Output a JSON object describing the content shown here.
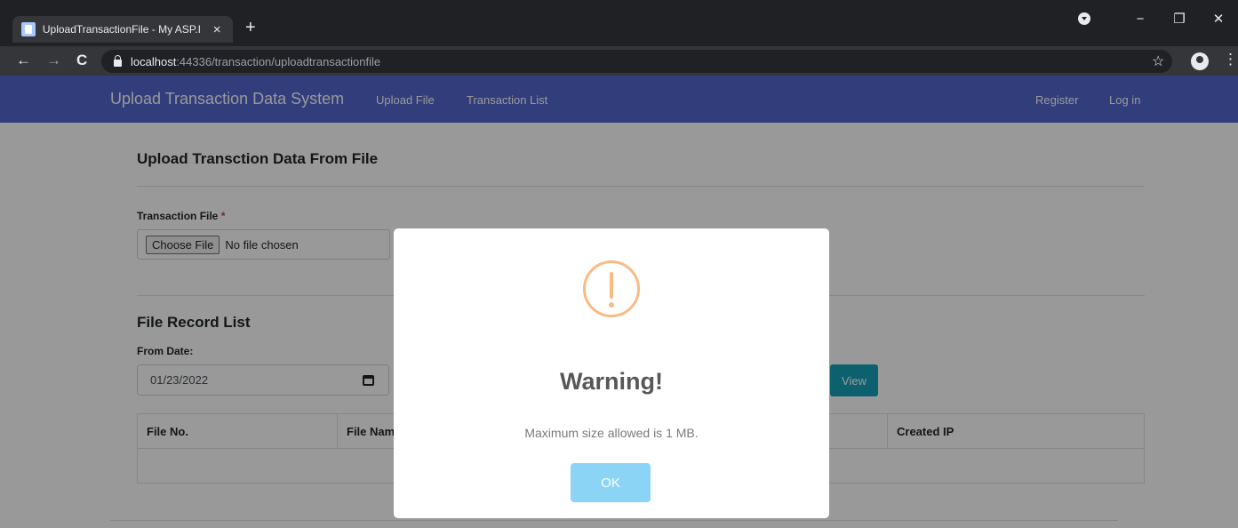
{
  "browser": {
    "tab_title": "UploadTransactionFile - My ASP.I",
    "tab_close": "×",
    "new_tab": "+",
    "url_host": "localhost",
    "url_rest": ":44336/transaction/uploadtransactionfile",
    "window_minimize": "−",
    "window_restore": "❐",
    "window_close": "✕",
    "back": "←",
    "forward": "→",
    "reload": "C",
    "bookmark": "☆",
    "menu": "⋮"
  },
  "navbar": {
    "brand": "Upload Transaction Data System",
    "links": [
      "Upload File",
      "Transaction List"
    ],
    "right_links": [
      "Register",
      "Log in"
    ]
  },
  "upload": {
    "title": "Upload Transction Data From File",
    "file_label": "Transaction File",
    "required_mark": "*",
    "choose_button": "Choose File",
    "file_status": "No file chosen"
  },
  "records": {
    "title": "File Record List",
    "from_label": "From Date:",
    "from_value": "01/23/2022",
    "view_button": "View",
    "columns": [
      "File No.",
      "File Nam",
      "",
      "Created IP"
    ]
  },
  "dialog": {
    "title": "Warning!",
    "message": "Maximum size allowed is 1 MB.",
    "ok": "OK",
    "icon": "warning-exclamation-icon",
    "icon_color": "#f8bb86",
    "ok_color": "#8cd4f5"
  },
  "colors": {
    "navbar": "#5466cf",
    "view_button": "#17a2b8"
  }
}
